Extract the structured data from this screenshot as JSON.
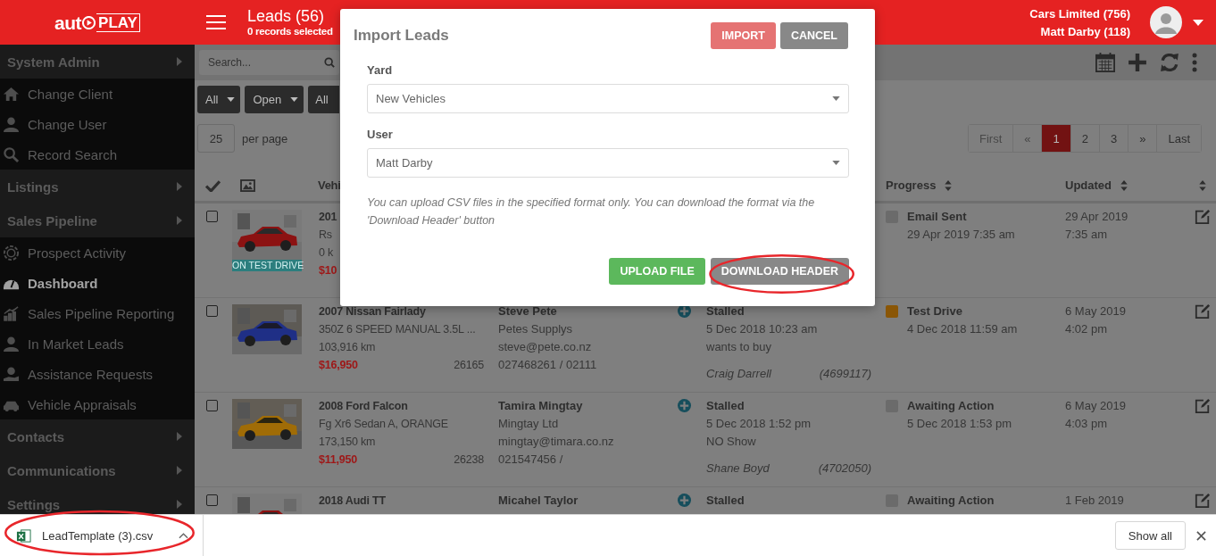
{
  "header": {
    "logo": {
      "prefix": "aut",
      "suffix": "PLAY"
    },
    "title": "Leads (56)",
    "subtitle": "0 records selected",
    "account": [
      "Cars Limited (756)",
      "Matt Darby (118)"
    ]
  },
  "sidebar": {
    "sections": [
      {
        "label": "System Admin",
        "children": [
          {
            "label": "Change Client",
            "selected": false
          },
          {
            "label": "Change User",
            "selected": false
          },
          {
            "label": "Record Search",
            "selected": false
          }
        ]
      },
      {
        "label": "Listings"
      },
      {
        "label": "Sales Pipeline",
        "children": [
          {
            "label": "Prospect Activity",
            "selected": false
          },
          {
            "label": "Dashboard",
            "selected": true
          },
          {
            "label": "Sales Pipeline Reporting",
            "selected": false
          },
          {
            "label": "In Market Leads",
            "selected": false
          },
          {
            "label": "Assistance Requests",
            "selected": false
          },
          {
            "label": "Vehicle Appraisals",
            "selected": false
          }
        ]
      },
      {
        "label": "Contacts"
      },
      {
        "label": "Communications"
      },
      {
        "label": "Settings"
      }
    ]
  },
  "toolbar": {
    "search": {
      "placeholder": "Search..."
    },
    "filters": [
      {
        "label": "All",
        "cut": false
      },
      {
        "label": "Open",
        "cut": false
      },
      {
        "label": "All",
        "cut": true
      }
    ],
    "page_size": "25",
    "page_size_label": "per page",
    "pagination": [
      {
        "label": "First",
        "selected": false,
        "disabled": true
      },
      {
        "label": "«",
        "selected": false,
        "disabled": true
      },
      {
        "label": "1",
        "selected": true,
        "disabled": false
      },
      {
        "label": "2",
        "selected": false,
        "disabled": false
      },
      {
        "label": "3",
        "selected": false,
        "disabled": false
      },
      {
        "label": "»",
        "selected": false,
        "disabled": false
      },
      {
        "label": "Last",
        "selected": false,
        "disabled": false
      }
    ]
  },
  "table": {
    "columns": [
      {
        "label": "Vehi",
        "sortable": false
      },
      {
        "label": "Progress",
        "sortable": true
      },
      {
        "label": "Updated",
        "sortable": true
      },
      {
        "sortable": true
      }
    ],
    "rows": [
      {
        "checked": false,
        "photo": {
          "kind": "picture"
        },
        "badge": "ON TEST DRIVE",
        "vehicle": {
          "title": "201",
          "detail": "Rs",
          "odometer": "0 k",
          "price": "$10"
        },
        "progress": {
          "label": "Email Sent",
          "date": "29 Apr 2019 7:35 am",
          "color": "#6b6b6b"
        },
        "updated": [
          "29 Apr 2019",
          "7:35 am"
        ]
      },
      {
        "checked": false,
        "photo": {
          "kind": "picture"
        },
        "vehicle": {
          "title": "2007 Nissan Fairlady",
          "detail": "350Z 6 SPEED MANUAL 3.5L ...",
          "odometer": "103,916 km",
          "price": "$16,950",
          "stock": "26165"
        },
        "contact": {
          "name": "Steve Pete",
          "company": "Petes Supplys",
          "email": "steve@pete.co.nz",
          "phone": "027468261 / 02111"
        },
        "status": {
          "label": "Stalled",
          "date": "5 Dec 2018 10:23 am",
          "note": "wants to buy",
          "agent": "Craig Darrell",
          "ref": "(4699117)"
        },
        "progress": {
          "label": "Test Drive",
          "date": "4 Dec 2018 11:59 am",
          "color": "#8a5606"
        },
        "updated": [
          "6 May 2019",
          "4:02 pm"
        ]
      },
      {
        "checked": false,
        "photo": {
          "kind": "picture"
        },
        "vehicle": {
          "title": "2008 Ford Falcon",
          "detail": "Fg Xr6 Sedan A, ORANGE",
          "odometer": "173,150 km",
          "price": "$11,950",
          "stock": "26238"
        },
        "contact": {
          "name": "Tamira Mingtay",
          "company": "Mingtay Ltd",
          "email": "mingtay@timara.co.nz",
          "phone": "021547456 /"
        },
        "status": {
          "label": "Stalled",
          "date": "5 Dec 2018 1:52 pm",
          "note": "NO Show",
          "agent": "Shane Boyd",
          "ref": "(4702050)"
        },
        "progress": {
          "label": "Awaiting Action",
          "date": "5 Dec 2018 1:53 pm",
          "color": "#6b6b6b"
        },
        "updated": [
          "6 May 2019",
          "4:03 pm"
        ]
      },
      {
        "checked": false,
        "photo": {
          "kind": "picture"
        },
        "vehicle": {
          "title": "2018 Audi TT"
        },
        "contact": {
          "name": "Micahel Taylor"
        },
        "status": {
          "label": "Stalled"
        },
        "progress": {
          "label": "Awaiting Action",
          "color": "#6b6b6b"
        },
        "updated": [
          "1 Feb 2019"
        ]
      }
    ]
  },
  "modal": {
    "title": "Import Leads",
    "actions": [
      {
        "label": "IMPORT",
        "kind": "primary",
        "disabled": true
      },
      {
        "label": "CANCEL",
        "kind": "secondary",
        "disabled": false
      }
    ],
    "fields": [
      {
        "label": "Yard",
        "value": "New Vehicles"
      },
      {
        "label": "User",
        "value": "Matt Darby"
      }
    ],
    "note": "You can upload CSV files in the specified format only. You can download the format via the 'Download Header' button",
    "buttons": [
      {
        "label": "UPLOAD FILE",
        "kind": "success",
        "highlighted": false
      },
      {
        "label": "DOWNLOAD HEADER",
        "kind": "secondary",
        "highlighted": true
      }
    ]
  },
  "download_bar": {
    "file": "LeadTemplate (3).csv",
    "highlighted": true,
    "show_all": "Show all"
  }
}
